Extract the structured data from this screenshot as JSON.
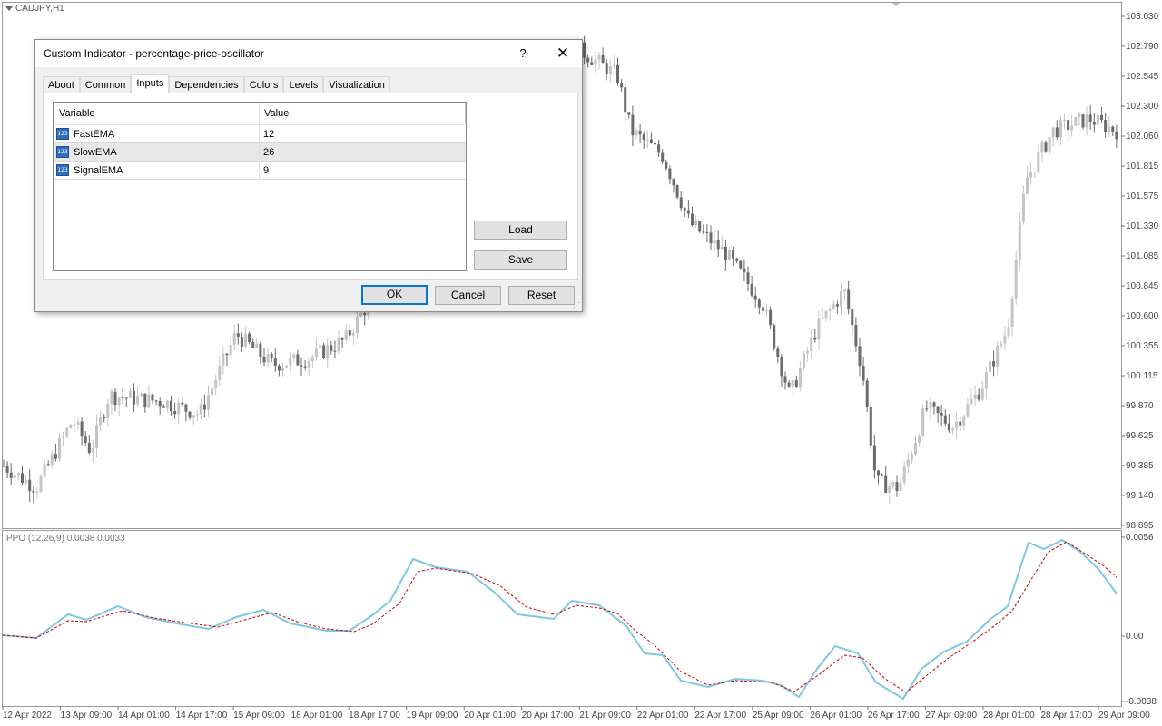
{
  "symbol": "CADJPY,H1",
  "ppo_label": "PPO (12,26,9) 0.0038 0.0033",
  "price_axis": [
    "103.030",
    "102.790",
    "102.545",
    "102.300",
    "102.060",
    "101.815",
    "101.575",
    "101.330",
    "101.085",
    "100.845",
    "100.600",
    "100.355",
    "100.115",
    "99.870",
    "99.625",
    "99.385",
    "99.140",
    "98.895"
  ],
  "ppo_axis": [
    "0.0056",
    "0.00",
    "-0.0038"
  ],
  "time_axis": [
    "12 Apr 2022",
    "13 Apr 09:00",
    "14 Apr 01:00",
    "14 Apr 17:00",
    "15 Apr 09:00",
    "18 Apr 01:00",
    "18 Apr 17:00",
    "19 Apr 09:00",
    "20 Apr 01:00",
    "20 Apr 17:00",
    "21 Apr 09:00",
    "22 Apr 01:00",
    "22 Apr 17:00",
    "25 Apr 09:00",
    "26 Apr 01:00",
    "26 Apr 17:00",
    "27 Apr 09:00",
    "28 Apr 01:00",
    "28 Apr 17:00",
    "29 Apr 09:00"
  ],
  "colors": {
    "ppo_line": "#7ec8e3",
    "signal_line": "#cc0000",
    "candle_dark": "#6b6b6b",
    "candle_light": "#c4c4c4",
    "grid_border": "#9a9a9a"
  },
  "dialog": {
    "title": "Custom Indicator - percentage-price-oscillator",
    "help": "?",
    "close": "✕",
    "tabs": [
      "About",
      "Common",
      "Inputs",
      "Dependencies",
      "Colors",
      "Levels",
      "Visualization"
    ],
    "active_tab": "Inputs",
    "columns": [
      "Variable",
      "Value"
    ],
    "rows": [
      {
        "icon": "123",
        "name": "FastEMA",
        "value": "12"
      },
      {
        "icon": "123",
        "name": "SlowEMA",
        "value": "26"
      },
      {
        "icon": "123",
        "name": "SignalEMA",
        "value": "9"
      }
    ],
    "load": "Load",
    "save": "Save",
    "ok": "OK",
    "cancel": "Cancel",
    "reset": "Reset"
  }
}
